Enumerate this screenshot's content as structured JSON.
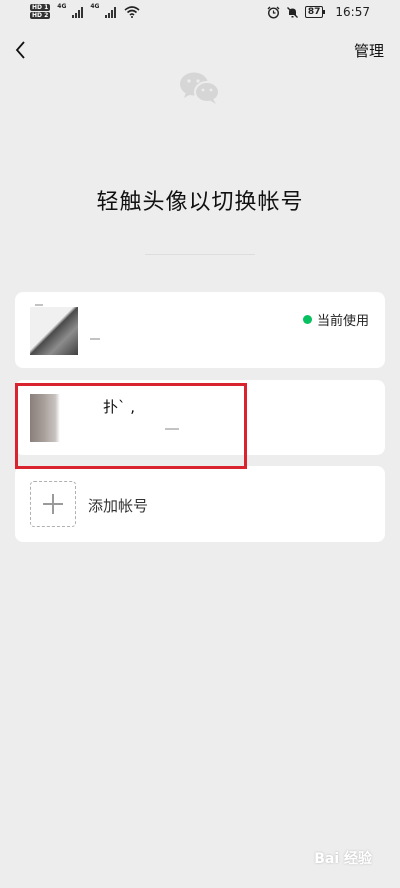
{
  "status_bar": {
    "hd1": "HD 1",
    "hd2": "HD 2",
    "net1": "4G",
    "net2": "4G",
    "battery": "87",
    "time": "16:57"
  },
  "nav": {
    "back_icon": "chevron-left-icon",
    "manage_label": "管理"
  },
  "logo_icon": "wechat-logo-icon",
  "title": "轻触头像以切换帐号",
  "accounts": [
    {
      "status_label": "当前使用",
      "status_color": "#07c160"
    },
    {
      "name": "扑` ,"
    }
  ],
  "add_account": {
    "icon": "plus-icon",
    "label": "添加帐号"
  },
  "annotation": {
    "color": "#d9232f"
  },
  "watermark": "Bai 经验"
}
